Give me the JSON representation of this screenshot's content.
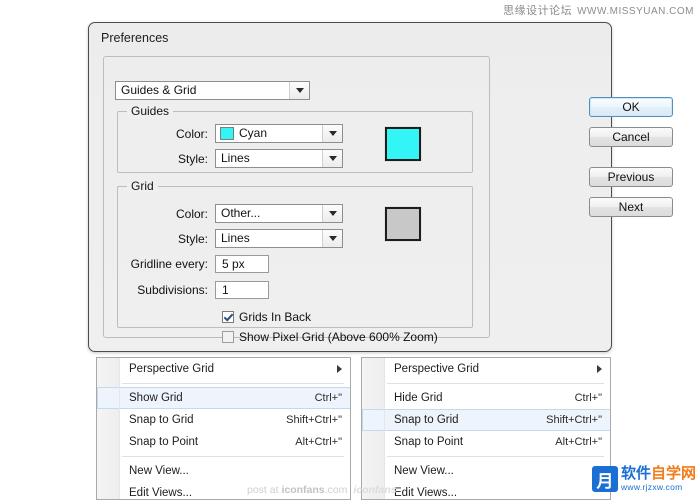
{
  "watermarks": {
    "top_cn": "思缘设计论坛",
    "top_url": "WWW.MISSYUAN.COM",
    "bottom_post": "post at ",
    "bottom_site": "iconfans",
    "bottom_suffix": ".com",
    "bottom_italic": "iconfans"
  },
  "logo": {
    "mark": "月",
    "cn_blue": "软件",
    "cn_orange": "自学网",
    "url": "www.rjzxw.com"
  },
  "dialog": {
    "title": "Preferences",
    "category": {
      "label": "Guides & Grid",
      "icon": "chevron-down-icon"
    },
    "guides": {
      "legend": "Guides",
      "color_label": "Color:",
      "color_value": "Cyan",
      "color_hex": "#33f5f5",
      "style_label": "Style:",
      "style_value": "Lines",
      "preview_hex": "#33f5f5"
    },
    "grid": {
      "legend": "Grid",
      "color_label": "Color:",
      "color_value": "Other...",
      "style_label": "Style:",
      "style_value": "Lines",
      "preview_hex": "#c8c8c8",
      "gridline_label": "Gridline every:",
      "gridline_value": "5 px",
      "subdivisions_label": "Subdivisions:",
      "subdivisions_value": "1",
      "grids_in_back_label": "Grids In Back",
      "grids_in_back_checked": true,
      "pixel_grid_label": "Show Pixel Grid (Above 600% Zoom)",
      "pixel_grid_checked": false
    },
    "buttons": {
      "ok": "OK",
      "cancel": "Cancel",
      "previous": "Previous",
      "next": "Next"
    }
  },
  "menu_left": {
    "items": [
      {
        "label": "Perspective Grid",
        "accel": "",
        "submenu": true,
        "selected": false
      },
      {
        "label": "Show Grid",
        "accel": "Ctrl+\"",
        "submenu": false,
        "selected": true
      },
      {
        "label": "Snap to Grid",
        "accel": "Shift+Ctrl+\"",
        "submenu": false,
        "selected": false
      },
      {
        "label": "Snap to Point",
        "accel": "Alt+Ctrl+\"",
        "submenu": false,
        "selected": false
      },
      {
        "label": "New View...",
        "accel": "",
        "submenu": false,
        "selected": false
      },
      {
        "label": "Edit Views...",
        "accel": "",
        "submenu": false,
        "selected": false
      }
    ]
  },
  "menu_right": {
    "items": [
      {
        "label": "Perspective Grid",
        "accel": "",
        "submenu": true,
        "selected": false
      },
      {
        "label": "Hide Grid",
        "accel": "Ctrl+\"",
        "submenu": false,
        "selected": false
      },
      {
        "label": "Snap to Grid",
        "accel": "Shift+Ctrl+\"",
        "submenu": false,
        "selected": true
      },
      {
        "label": "Snap to Point",
        "accel": "Alt+Ctrl+\"",
        "submenu": false,
        "selected": false
      },
      {
        "label": "New View...",
        "accel": "",
        "submenu": false,
        "selected": false
      },
      {
        "label": "Edit Views...",
        "accel": "",
        "submenu": false,
        "selected": false
      }
    ]
  }
}
